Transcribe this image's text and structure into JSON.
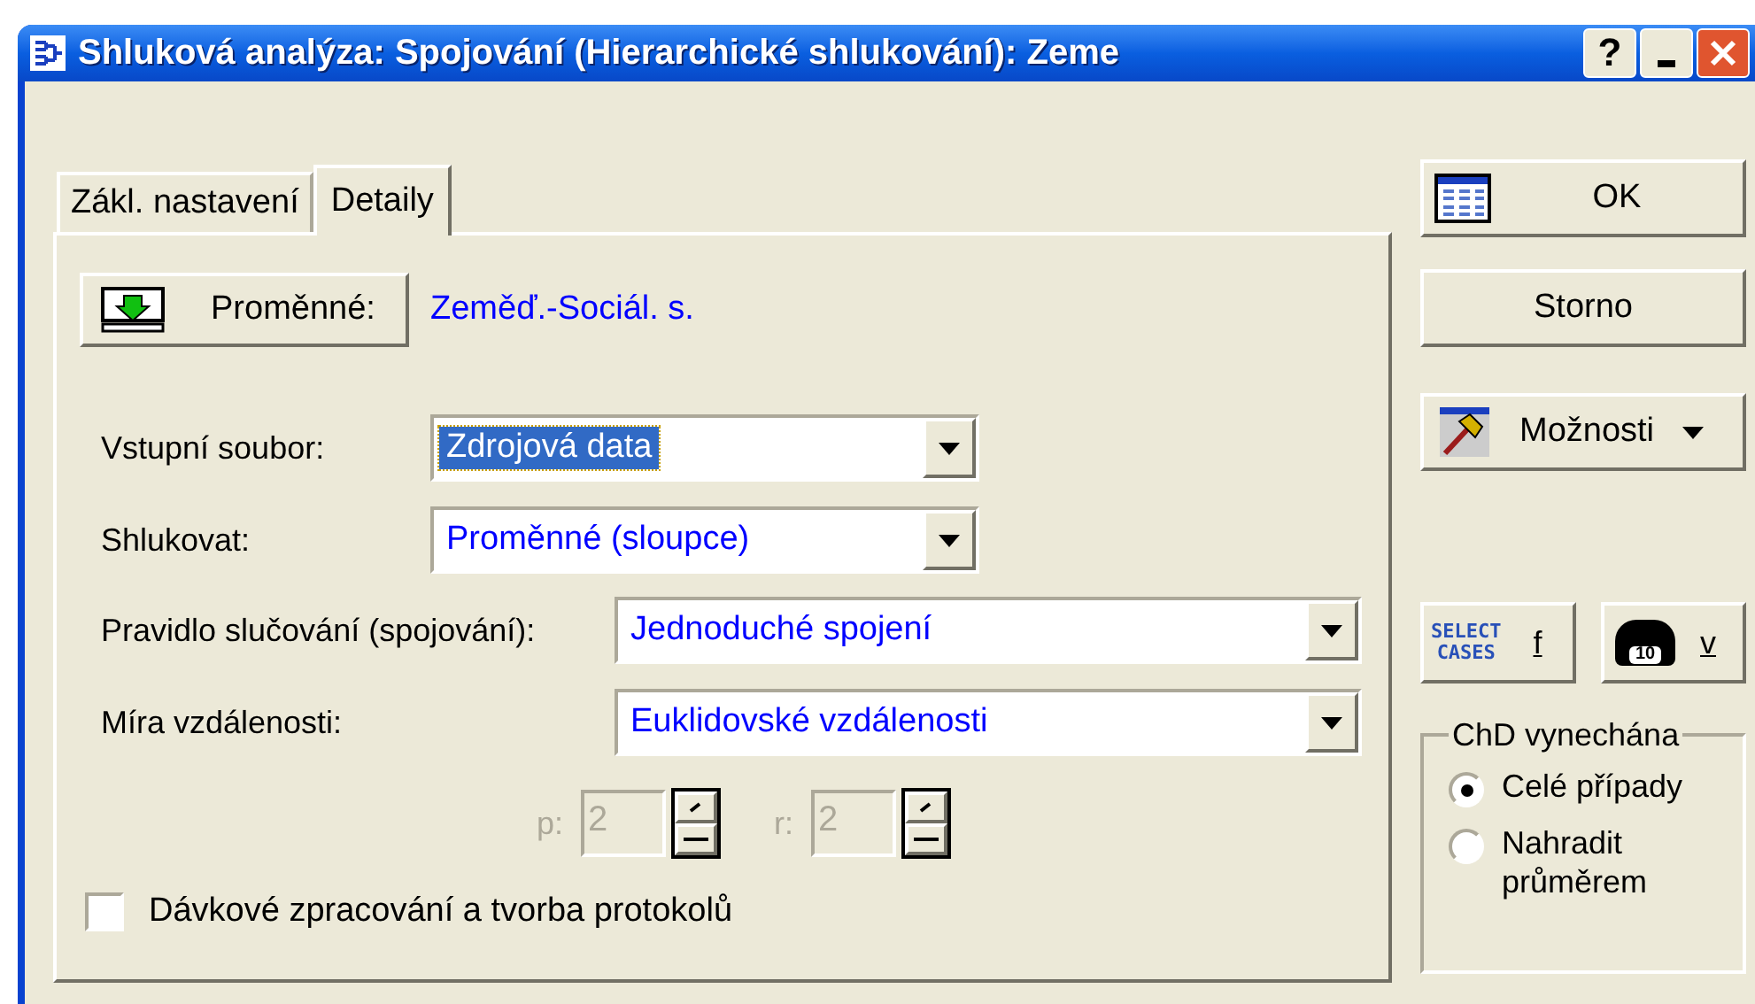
{
  "window": {
    "title": "Shluková analýza: Spojování (Hierarchické shlukování): Zeme",
    "help_glyph": "?"
  },
  "tabs": [
    {
      "label": "Zákl. nastavení",
      "selected": false
    },
    {
      "label": "Detaily",
      "selected": true
    }
  ],
  "variables": {
    "button": "Proměnné:",
    "value": "Zeměď.-Sociál. s."
  },
  "combos": [
    {
      "label": "Vstupní soubor:",
      "value": "Zdrojová data",
      "focused": true,
      "kind": "short"
    },
    {
      "label": "Shlukovat:",
      "value": "Proměnné (sloupce)",
      "focused": false,
      "kind": "short"
    },
    {
      "label": "Pravidlo slučování (spojování):",
      "value": "Jednoduché spojení",
      "focused": false,
      "kind": "wide"
    },
    {
      "label": "Míra vzdálenosti:",
      "value": "Euklidovské vzdálenosti",
      "focused": false,
      "kind": "wide"
    }
  ],
  "spinners": [
    {
      "label": "p:",
      "value": "2",
      "disabled": true
    },
    {
      "label": "r:",
      "value": "2",
      "disabled": true
    }
  ],
  "batch": {
    "label": "Dávkové zpracování a tvorba protokolů",
    "checked": false
  },
  "buttons": {
    "ok": "OK",
    "cancel": "Storno",
    "options": "Možnosti"
  },
  "select_cases": {
    "icon_text": [
      "SELECT",
      "CASES"
    ],
    "label": "f"
  },
  "weight": {
    "icon_text": "10",
    "label": "v"
  },
  "missing": {
    "title": "ChD vynechána",
    "options": [
      {
        "label": "Celé případy",
        "selected": true
      },
      {
        "label": "Nahradit průměrem",
        "selected": false
      }
    ]
  }
}
